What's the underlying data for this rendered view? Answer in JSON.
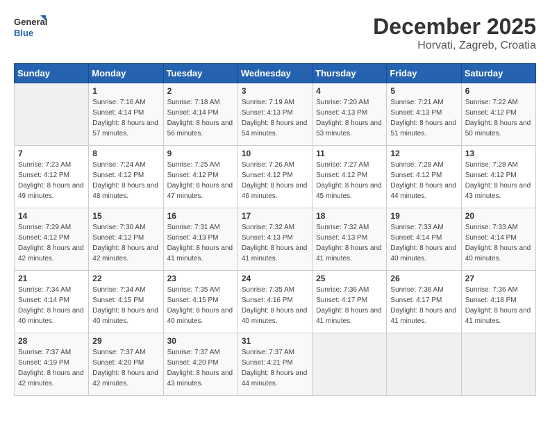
{
  "logo": {
    "line1": "General",
    "line2": "Blue"
  },
  "title": "December 2025",
  "location": "Horvati, Zagreb, Croatia",
  "headers": [
    "Sunday",
    "Monday",
    "Tuesday",
    "Wednesday",
    "Thursday",
    "Friday",
    "Saturday"
  ],
  "weeks": [
    [
      {
        "day": "",
        "sunrise": "",
        "sunset": "",
        "daylight": ""
      },
      {
        "day": "1",
        "sunrise": "Sunrise: 7:16 AM",
        "sunset": "Sunset: 4:14 PM",
        "daylight": "Daylight: 8 hours and 57 minutes."
      },
      {
        "day": "2",
        "sunrise": "Sunrise: 7:18 AM",
        "sunset": "Sunset: 4:14 PM",
        "daylight": "Daylight: 8 hours and 56 minutes."
      },
      {
        "day": "3",
        "sunrise": "Sunrise: 7:19 AM",
        "sunset": "Sunset: 4:13 PM",
        "daylight": "Daylight: 8 hours and 54 minutes."
      },
      {
        "day": "4",
        "sunrise": "Sunrise: 7:20 AM",
        "sunset": "Sunset: 4:13 PM",
        "daylight": "Daylight: 8 hours and 53 minutes."
      },
      {
        "day": "5",
        "sunrise": "Sunrise: 7:21 AM",
        "sunset": "Sunset: 4:13 PM",
        "daylight": "Daylight: 8 hours and 51 minutes."
      },
      {
        "day": "6",
        "sunrise": "Sunrise: 7:22 AM",
        "sunset": "Sunset: 4:12 PM",
        "daylight": "Daylight: 8 hours and 50 minutes."
      }
    ],
    [
      {
        "day": "7",
        "sunrise": "Sunrise: 7:23 AM",
        "sunset": "Sunset: 4:12 PM",
        "daylight": "Daylight: 8 hours and 49 minutes."
      },
      {
        "day": "8",
        "sunrise": "Sunrise: 7:24 AM",
        "sunset": "Sunset: 4:12 PM",
        "daylight": "Daylight: 8 hours and 48 minutes."
      },
      {
        "day": "9",
        "sunrise": "Sunrise: 7:25 AM",
        "sunset": "Sunset: 4:12 PM",
        "daylight": "Daylight: 8 hours and 47 minutes."
      },
      {
        "day": "10",
        "sunrise": "Sunrise: 7:26 AM",
        "sunset": "Sunset: 4:12 PM",
        "daylight": "Daylight: 8 hours and 46 minutes."
      },
      {
        "day": "11",
        "sunrise": "Sunrise: 7:27 AM",
        "sunset": "Sunset: 4:12 PM",
        "daylight": "Daylight: 8 hours and 45 minutes."
      },
      {
        "day": "12",
        "sunrise": "Sunrise: 7:28 AM",
        "sunset": "Sunset: 4:12 PM",
        "daylight": "Daylight: 8 hours and 44 minutes."
      },
      {
        "day": "13",
        "sunrise": "Sunrise: 7:28 AM",
        "sunset": "Sunset: 4:12 PM",
        "daylight": "Daylight: 8 hours and 43 minutes."
      }
    ],
    [
      {
        "day": "14",
        "sunrise": "Sunrise: 7:29 AM",
        "sunset": "Sunset: 4:12 PM",
        "daylight": "Daylight: 8 hours and 42 minutes."
      },
      {
        "day": "15",
        "sunrise": "Sunrise: 7:30 AM",
        "sunset": "Sunset: 4:12 PM",
        "daylight": "Daylight: 8 hours and 42 minutes."
      },
      {
        "day": "16",
        "sunrise": "Sunrise: 7:31 AM",
        "sunset": "Sunset: 4:13 PM",
        "daylight": "Daylight: 8 hours and 41 minutes."
      },
      {
        "day": "17",
        "sunrise": "Sunrise: 7:32 AM",
        "sunset": "Sunset: 4:13 PM",
        "daylight": "Daylight: 8 hours and 41 minutes."
      },
      {
        "day": "18",
        "sunrise": "Sunrise: 7:32 AM",
        "sunset": "Sunset: 4:13 PM",
        "daylight": "Daylight: 8 hours and 41 minutes."
      },
      {
        "day": "19",
        "sunrise": "Sunrise: 7:33 AM",
        "sunset": "Sunset: 4:14 PM",
        "daylight": "Daylight: 8 hours and 40 minutes."
      },
      {
        "day": "20",
        "sunrise": "Sunrise: 7:33 AM",
        "sunset": "Sunset: 4:14 PM",
        "daylight": "Daylight: 8 hours and 40 minutes."
      }
    ],
    [
      {
        "day": "21",
        "sunrise": "Sunrise: 7:34 AM",
        "sunset": "Sunset: 4:14 PM",
        "daylight": "Daylight: 8 hours and 40 minutes."
      },
      {
        "day": "22",
        "sunrise": "Sunrise: 7:34 AM",
        "sunset": "Sunset: 4:15 PM",
        "daylight": "Daylight: 8 hours and 40 minutes."
      },
      {
        "day": "23",
        "sunrise": "Sunrise: 7:35 AM",
        "sunset": "Sunset: 4:15 PM",
        "daylight": "Daylight: 8 hours and 40 minutes."
      },
      {
        "day": "24",
        "sunrise": "Sunrise: 7:35 AM",
        "sunset": "Sunset: 4:16 PM",
        "daylight": "Daylight: 8 hours and 40 minutes."
      },
      {
        "day": "25",
        "sunrise": "Sunrise: 7:36 AM",
        "sunset": "Sunset: 4:17 PM",
        "daylight": "Daylight: 8 hours and 41 minutes."
      },
      {
        "day": "26",
        "sunrise": "Sunrise: 7:36 AM",
        "sunset": "Sunset: 4:17 PM",
        "daylight": "Daylight: 8 hours and 41 minutes."
      },
      {
        "day": "27",
        "sunrise": "Sunrise: 7:36 AM",
        "sunset": "Sunset: 4:18 PM",
        "daylight": "Daylight: 8 hours and 41 minutes."
      }
    ],
    [
      {
        "day": "28",
        "sunrise": "Sunrise: 7:37 AM",
        "sunset": "Sunset: 4:19 PM",
        "daylight": "Daylight: 8 hours and 42 minutes."
      },
      {
        "day": "29",
        "sunrise": "Sunrise: 7:37 AM",
        "sunset": "Sunset: 4:20 PM",
        "daylight": "Daylight: 8 hours and 42 minutes."
      },
      {
        "day": "30",
        "sunrise": "Sunrise: 7:37 AM",
        "sunset": "Sunset: 4:20 PM",
        "daylight": "Daylight: 8 hours and 43 minutes."
      },
      {
        "day": "31",
        "sunrise": "Sunrise: 7:37 AM",
        "sunset": "Sunset: 4:21 PM",
        "daylight": "Daylight: 8 hours and 44 minutes."
      },
      {
        "day": "",
        "sunrise": "",
        "sunset": "",
        "daylight": ""
      },
      {
        "day": "",
        "sunrise": "",
        "sunset": "",
        "daylight": ""
      },
      {
        "day": "",
        "sunrise": "",
        "sunset": "",
        "daylight": ""
      }
    ]
  ]
}
